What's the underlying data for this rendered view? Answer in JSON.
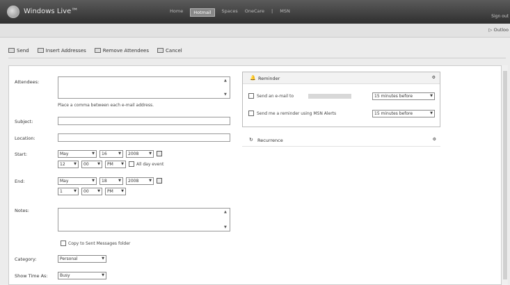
{
  "header": {
    "brand": "Windows Live™",
    "nav": [
      "Home",
      "Hotmail",
      "Spaces",
      "OneCare",
      "|",
      "MSN"
    ],
    "active_nav": "Hotmail",
    "signout": "Sign out",
    "outlook_link": "Outloo"
  },
  "toolbar": {
    "send": "Send",
    "insert_addresses": "Insert Addresses",
    "remove_attendees": "Remove Attendees",
    "cancel": "Cancel"
  },
  "form": {
    "attendees_label": "Attendees:",
    "attendees_hint": "Place a comma between each e-mail address.",
    "subject_label": "Subject:",
    "location_label": "Location:",
    "start_label": "Start:",
    "end_label": "End:",
    "start": {
      "month": "May",
      "day": "16",
      "year": "2008",
      "hour": "12",
      "minute": "00",
      "ampm": "PM",
      "all_day": "All day event"
    },
    "end": {
      "month": "May",
      "day": "18",
      "year": "2008",
      "hour": "1",
      "minute": "00",
      "ampm": "PM"
    },
    "notes_label": "Notes:",
    "copy_sent": "Copy to Sent Messages folder",
    "category_label": "Category:",
    "category_value": "Personal",
    "show_time_label": "Show Time As:",
    "show_time_value": "Busy"
  },
  "reminder": {
    "title": "Reminder",
    "email_text": "Send an e-mail to",
    "email_select": "15 minutes before",
    "alert_text": "Send me a reminder using MSN Alerts",
    "alert_select": "15 minutes before"
  },
  "recurrence": {
    "title": "Recurrence"
  }
}
